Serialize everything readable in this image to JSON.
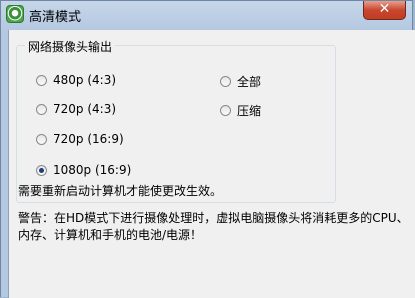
{
  "window": {
    "title": "高清模式",
    "close_label": "✕"
  },
  "group": {
    "legend": "网络摄像头输出",
    "options": [
      {
        "label": "480p (4:3)",
        "checked": false
      },
      {
        "label": "720p (4:3)",
        "checked": false
      },
      {
        "label": "720p (16:9)",
        "checked": false
      },
      {
        "label": "1080p (16:9)",
        "checked": true
      },
      {
        "label": "全部",
        "checked": false
      },
      {
        "label": "压缩",
        "checked": false
      }
    ]
  },
  "notice": "需要重新启动计算机才能使更改生效。",
  "warning": "警告：在HD模式下进行摄像处理时，虚拟电脑摄像头将消耗更多的CPU、内存、计算机和手机的电池/电源！",
  "icons": {
    "app": "app-icon",
    "close": "close-icon"
  }
}
